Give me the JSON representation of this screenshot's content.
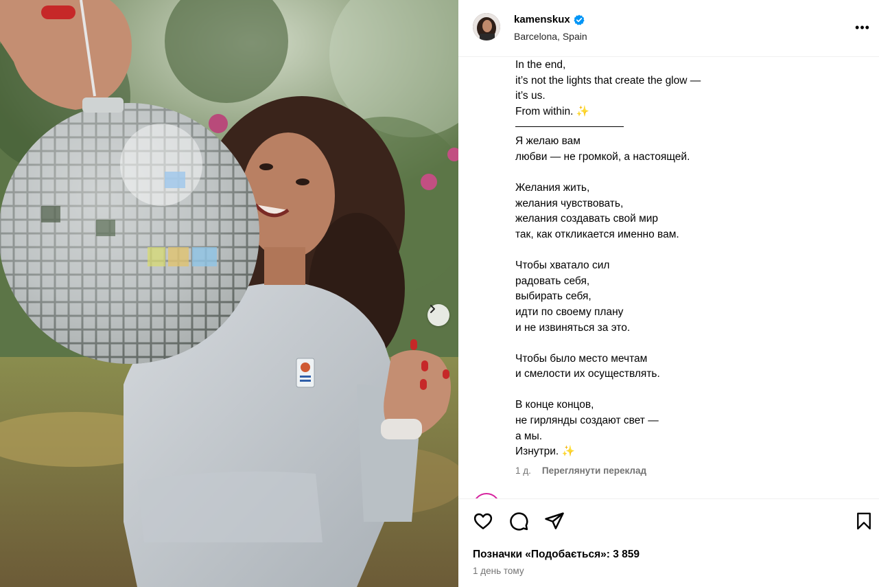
{
  "header": {
    "username": "kamenskux",
    "location": "Barcelona, Spain",
    "more_label": "•••"
  },
  "caption": {
    "lines": [
      "In the end,",
      "it’s not the lights that create the glow —",
      "it’s us.",
      "From within. ✨",
      "---",
      "Я желаю вам",
      "любви — не громкой, а настоящей.",
      "",
      "Желания жить,",
      "желания чувствовать,",
      "желания создавать свой мир",
      "так, как откликается именно вам.",
      "",
      "Чтобы хватало сил",
      "радовать себя,",
      "выбирать себя,",
      "идти по своему плану",
      "и не извиняться за это.",
      "",
      "Чтобы было место мечтам",
      "и смелости их осуществлять.",
      "",
      "В конце концов,",
      "не гирлянды создают свет —",
      "а мы.",
      "Изнутри. ✨"
    ],
    "age": "1 д.",
    "see_translation": "Переглянути переклад"
  },
  "footer": {
    "likes_text": "Позначки «Подобається»: 3 859",
    "posted": "1 день тому"
  },
  "colors": {
    "verified_badge": "#0095f6",
    "story_ring": "#d6249f",
    "muted_text": "#737373",
    "divider": "#efefef"
  },
  "icons": [
    "verified-icon",
    "more-icon",
    "chevron-right-icon",
    "heart-icon",
    "comment-icon",
    "share-icon",
    "bookmark-icon"
  ]
}
